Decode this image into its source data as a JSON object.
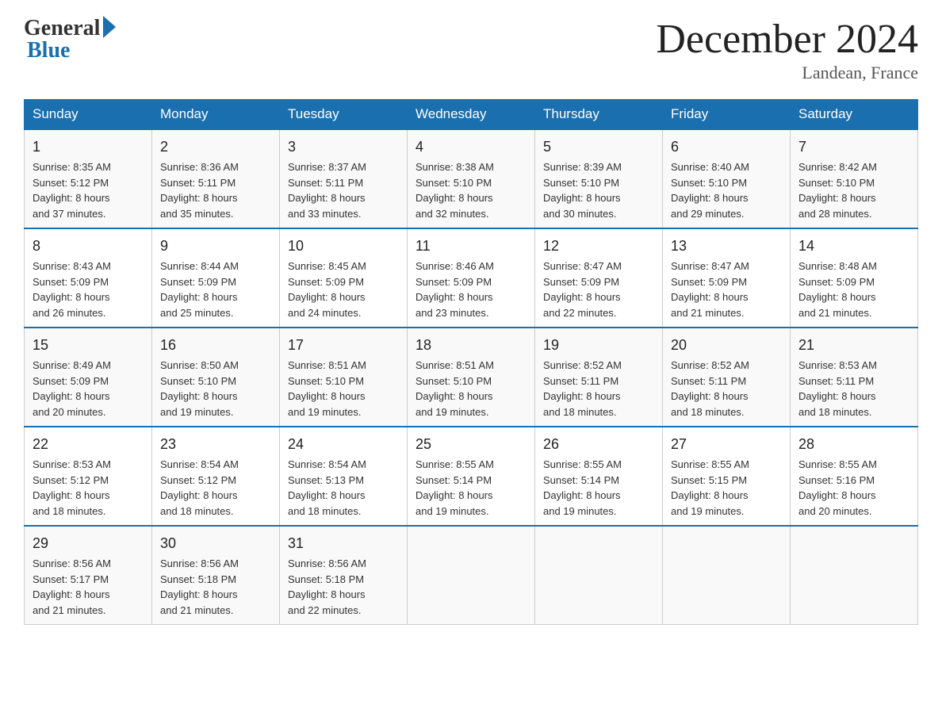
{
  "logo": {
    "general": "General",
    "blue": "Blue"
  },
  "title": "December 2024",
  "location": "Landean, France",
  "days_of_week": [
    "Sunday",
    "Monday",
    "Tuesday",
    "Wednesday",
    "Thursday",
    "Friday",
    "Saturday"
  ],
  "weeks": [
    [
      {
        "day": "1",
        "sunrise": "8:35 AM",
        "sunset": "5:12 PM",
        "daylight": "8 hours and 37 minutes."
      },
      {
        "day": "2",
        "sunrise": "8:36 AM",
        "sunset": "5:11 PM",
        "daylight": "8 hours and 35 minutes."
      },
      {
        "day": "3",
        "sunrise": "8:37 AM",
        "sunset": "5:11 PM",
        "daylight": "8 hours and 33 minutes."
      },
      {
        "day": "4",
        "sunrise": "8:38 AM",
        "sunset": "5:10 PM",
        "daylight": "8 hours and 32 minutes."
      },
      {
        "day": "5",
        "sunrise": "8:39 AM",
        "sunset": "5:10 PM",
        "daylight": "8 hours and 30 minutes."
      },
      {
        "day": "6",
        "sunrise": "8:40 AM",
        "sunset": "5:10 PM",
        "daylight": "8 hours and 29 minutes."
      },
      {
        "day": "7",
        "sunrise": "8:42 AM",
        "sunset": "5:10 PM",
        "daylight": "8 hours and 28 minutes."
      }
    ],
    [
      {
        "day": "8",
        "sunrise": "8:43 AM",
        "sunset": "5:09 PM",
        "daylight": "8 hours and 26 minutes."
      },
      {
        "day": "9",
        "sunrise": "8:44 AM",
        "sunset": "5:09 PM",
        "daylight": "8 hours and 25 minutes."
      },
      {
        "day": "10",
        "sunrise": "8:45 AM",
        "sunset": "5:09 PM",
        "daylight": "8 hours and 24 minutes."
      },
      {
        "day": "11",
        "sunrise": "8:46 AM",
        "sunset": "5:09 PM",
        "daylight": "8 hours and 23 minutes."
      },
      {
        "day": "12",
        "sunrise": "8:47 AM",
        "sunset": "5:09 PM",
        "daylight": "8 hours and 22 minutes."
      },
      {
        "day": "13",
        "sunrise": "8:47 AM",
        "sunset": "5:09 PM",
        "daylight": "8 hours and 21 minutes."
      },
      {
        "day": "14",
        "sunrise": "8:48 AM",
        "sunset": "5:09 PM",
        "daylight": "8 hours and 21 minutes."
      }
    ],
    [
      {
        "day": "15",
        "sunrise": "8:49 AM",
        "sunset": "5:09 PM",
        "daylight": "8 hours and 20 minutes."
      },
      {
        "day": "16",
        "sunrise": "8:50 AM",
        "sunset": "5:10 PM",
        "daylight": "8 hours and 19 minutes."
      },
      {
        "day": "17",
        "sunrise": "8:51 AM",
        "sunset": "5:10 PM",
        "daylight": "8 hours and 19 minutes."
      },
      {
        "day": "18",
        "sunrise": "8:51 AM",
        "sunset": "5:10 PM",
        "daylight": "8 hours and 19 minutes."
      },
      {
        "day": "19",
        "sunrise": "8:52 AM",
        "sunset": "5:11 PM",
        "daylight": "8 hours and 18 minutes."
      },
      {
        "day": "20",
        "sunrise": "8:52 AM",
        "sunset": "5:11 PM",
        "daylight": "8 hours and 18 minutes."
      },
      {
        "day": "21",
        "sunrise": "8:53 AM",
        "sunset": "5:11 PM",
        "daylight": "8 hours and 18 minutes."
      }
    ],
    [
      {
        "day": "22",
        "sunrise": "8:53 AM",
        "sunset": "5:12 PM",
        "daylight": "8 hours and 18 minutes."
      },
      {
        "day": "23",
        "sunrise": "8:54 AM",
        "sunset": "5:12 PM",
        "daylight": "8 hours and 18 minutes."
      },
      {
        "day": "24",
        "sunrise": "8:54 AM",
        "sunset": "5:13 PM",
        "daylight": "8 hours and 18 minutes."
      },
      {
        "day": "25",
        "sunrise": "8:55 AM",
        "sunset": "5:14 PM",
        "daylight": "8 hours and 19 minutes."
      },
      {
        "day": "26",
        "sunrise": "8:55 AM",
        "sunset": "5:14 PM",
        "daylight": "8 hours and 19 minutes."
      },
      {
        "day": "27",
        "sunrise": "8:55 AM",
        "sunset": "5:15 PM",
        "daylight": "8 hours and 19 minutes."
      },
      {
        "day": "28",
        "sunrise": "8:55 AM",
        "sunset": "5:16 PM",
        "daylight": "8 hours and 20 minutes."
      }
    ],
    [
      {
        "day": "29",
        "sunrise": "8:56 AM",
        "sunset": "5:17 PM",
        "daylight": "8 hours and 21 minutes."
      },
      {
        "day": "30",
        "sunrise": "8:56 AM",
        "sunset": "5:18 PM",
        "daylight": "8 hours and 21 minutes."
      },
      {
        "day": "31",
        "sunrise": "8:56 AM",
        "sunset": "5:18 PM",
        "daylight": "8 hours and 22 minutes."
      },
      null,
      null,
      null,
      null
    ]
  ],
  "labels": {
    "sunrise": "Sunrise:",
    "sunset": "Sunset:",
    "daylight": "Daylight:"
  }
}
